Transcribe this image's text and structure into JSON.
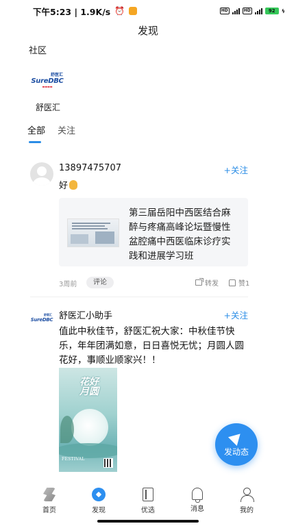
{
  "status_bar": {
    "time_speed": "下午5:23 | 1.9K/s",
    "battery": "92"
  },
  "header": {
    "title": "发现"
  },
  "community": {
    "label": "社区",
    "items": [
      {
        "name": "舒医汇",
        "logo_main": "Sure",
        "logo_accent": "DBC",
        "logo_top": "舒医汇"
      }
    ]
  },
  "tabs": [
    {
      "label": "全部",
      "active": true
    },
    {
      "label": "关注",
      "active": false
    }
  ],
  "posts": [
    {
      "author": "13897475707",
      "follow_label": "+关注",
      "text": "好",
      "emoji": "ok-hand",
      "link_card": {
        "title": "第三届岳阳中西医结合麻醉与疼痛高峰论坛暨慢性盆腔痛中西医临床诊疗实践和进展学习班"
      },
      "time": "3周前",
      "comment_label": "评论",
      "share_label": "转发",
      "like_label": "赞1"
    },
    {
      "author": "舒医汇小助手",
      "follow_label": "+关注",
      "text": "值此中秋佳节，舒医汇祝大家：中秋佳节快乐，年年团满如意，日日喜悦无忧；月圆人圆花好，事顺业顺家兴！！",
      "poster": {
        "title": "花好月圆",
        "footer": "FESTIVAL"
      }
    }
  ],
  "fab": {
    "label": "发动态"
  },
  "bottom_nav": [
    {
      "label": "首页",
      "icon": "home-logo-icon",
      "active": false
    },
    {
      "label": "发现",
      "icon": "compass-icon",
      "active": true
    },
    {
      "label": "优选",
      "icon": "book-icon",
      "active": false
    },
    {
      "label": "消息",
      "icon": "bell-icon",
      "active": false
    },
    {
      "label": "我的",
      "icon": "user-icon",
      "active": false
    }
  ],
  "colors": {
    "accent": "#2d8ff0",
    "follow": "#2b8de6",
    "card_bg": "#f5f6f8"
  }
}
